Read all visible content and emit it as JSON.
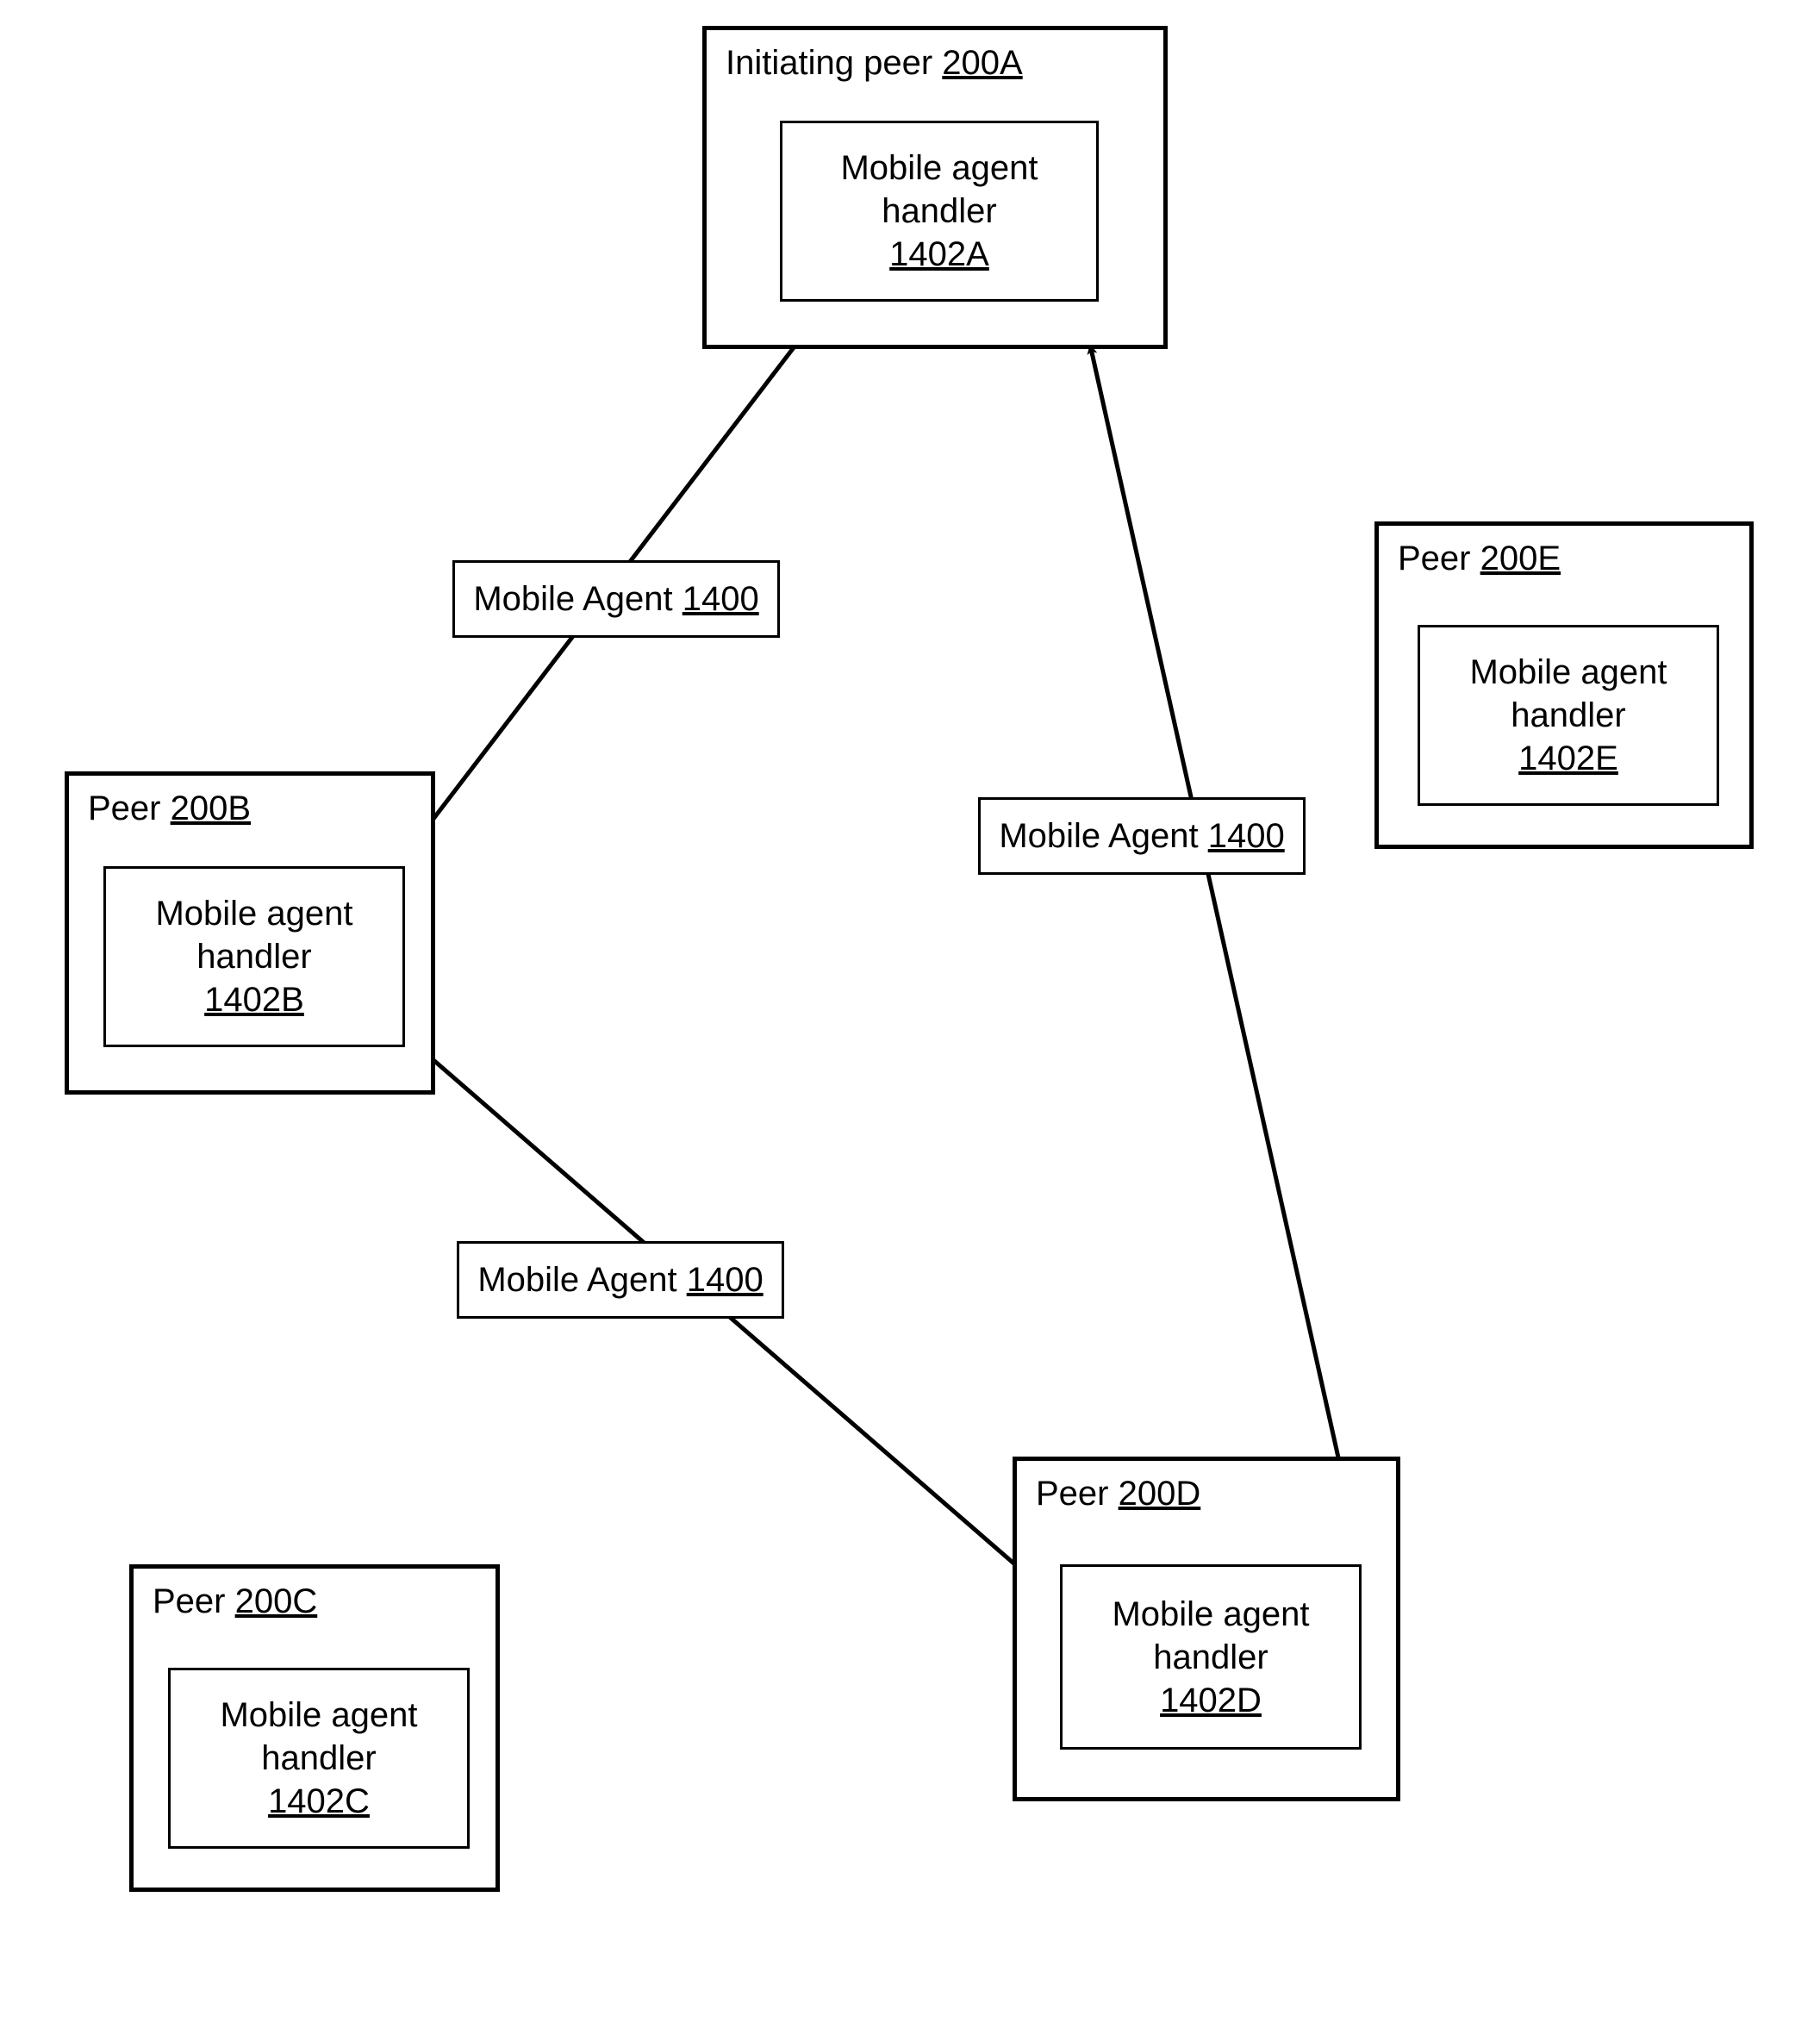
{
  "peers": {
    "A": {
      "title_prefix": "Initiating peer ",
      "title_id": "200A"
    },
    "B": {
      "title_prefix": "Peer ",
      "title_id": "200B"
    },
    "C": {
      "title_prefix": "Peer ",
      "title_id": "200C"
    },
    "D": {
      "title_prefix": "Peer ",
      "title_id": "200D"
    },
    "E": {
      "title_prefix": "Peer ",
      "title_id": "200E"
    }
  },
  "handlers": {
    "A": {
      "line1": "Mobile agent",
      "line2": "handler",
      "id": "1402A"
    },
    "B": {
      "line1": "Mobile agent",
      "line2": "handler",
      "id": "1402B"
    },
    "C": {
      "line1": "Mobile agent",
      "line2": "handler",
      "id": "1402C"
    },
    "D": {
      "line1": "Mobile agent",
      "line2": "handler",
      "id": "1402D"
    },
    "E": {
      "line1": "Mobile agent",
      "line2": "handler",
      "id": "1402E"
    }
  },
  "agents": {
    "AB": {
      "label": "Mobile Agent ",
      "id": "1400"
    },
    "BD": {
      "label": "Mobile Agent ",
      "id": "1400"
    },
    "DA": {
      "label": "Mobile Agent ",
      "id": "1400"
    }
  },
  "flow": {
    "description": "Mobile agent 1400 travels from initiating peer 200A to peer 200B, then to peer 200D, then back to peer 200A. Peers 200C and 200E are present but not visited."
  }
}
